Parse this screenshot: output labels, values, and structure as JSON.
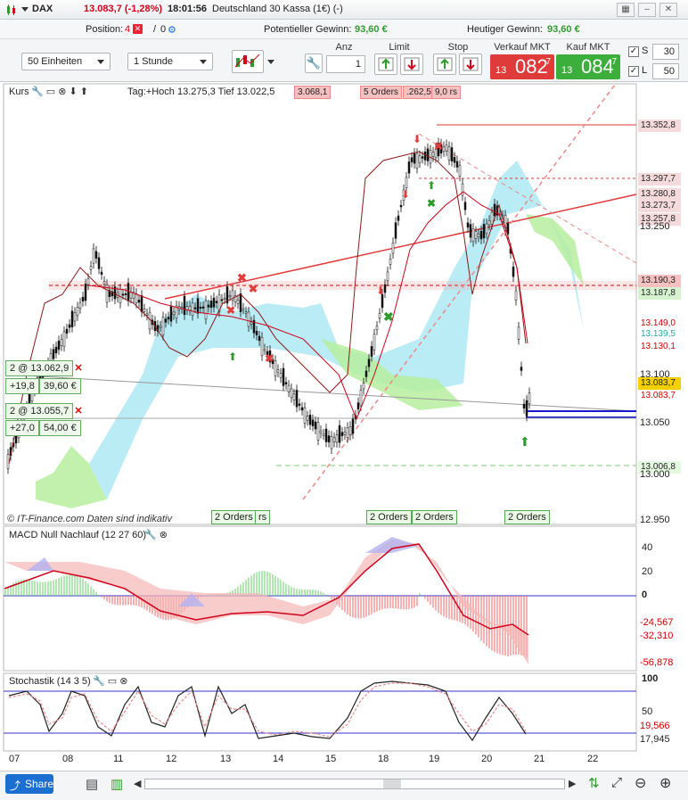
{
  "titlebar": {
    "instrument": "DAX",
    "price_change": "13.083,7 (-1,28%)",
    "time": "18:01:56",
    "instrument_full": "Deutschland 30 Kassa (1€) (-)"
  },
  "info_row": {
    "position_label": "Position:",
    "position_value": "4",
    "position_orders": "0",
    "potential_label": "Potentieller Gewinn:",
    "potential_value": "93,60 €",
    "today_label": "Heutiger Gewinn:",
    "today_value": "93,60 €"
  },
  "toolbar": {
    "units_select": "50 Einheiten",
    "timeframe_select": "1 Stunde",
    "qty_label": "Anz",
    "qty_value": "1",
    "limit_label": "Limit",
    "stop_label": "Stop",
    "sell_label": "Verkauf MKT",
    "buy_label": "Kauf MKT",
    "sell_small": "13",
    "sell_big": "082",
    "sell_sup": "7",
    "buy_small": "13",
    "buy_big": "084",
    "buy_sup": "7",
    "s_label": "S",
    "s_value": "30",
    "l_label": "L",
    "l_value": "50"
  },
  "price_panel": {
    "label": "Kurs",
    "header_info": "Tag:+Hoch 13.275,3 Tief 13.022,5",
    "header_orders_1": "3.068,1",
    "header_orders_2": "5 Orders",
    "header_orders_3": ".262,5",
    "header_orders_4": "9,0 rs",
    "watermark": "© IT-Finance.com  Daten sind indikativ",
    "y_ticks": [
      "13.250",
      "13.100",
      "13.050",
      "13.000",
      "12.950"
    ],
    "price_tags": [
      {
        "value": "13.352,8",
        "bg": "#f4dada",
        "fg": "#222"
      },
      {
        "value": "13.297,7",
        "bg": "#f4dada",
        "fg": "#222"
      },
      {
        "value": "13.280,8",
        "bg": "#f4dada",
        "fg": "#222"
      },
      {
        "value": "13.273,7",
        "bg": "#f4dada",
        "fg": "#222"
      },
      {
        "value": "13.257,8",
        "bg": "#f4dada",
        "fg": "#222"
      },
      {
        "value": "13.190,3",
        "bg": "#f4c0c0",
        "fg": "#222"
      },
      {
        "value": "13.187,8",
        "bg": "#d6f3d0",
        "fg": "#222"
      },
      {
        "value": "13.149,0",
        "bg": "#ffffff",
        "fg": "#c00"
      },
      {
        "value": "13.139,5",
        "bg": "#ffffff",
        "fg": "#2aa"
      },
      {
        "value": "13.130,1",
        "bg": "#ffffff",
        "fg": "#c00"
      },
      {
        "value": "13.083,7",
        "bg": "#f5d000",
        "fg": "#222"
      },
      {
        "value": "13.083,7",
        "bg": "#ffffff",
        "fg": "#c00"
      },
      {
        "value": "13.006,8",
        "bg": "#e4f7df",
        "fg": "#222"
      }
    ],
    "positions": [
      {
        "label": "2 @ 13.062,9",
        "pnl_points": "+19,8",
        "pnl_eur": "39,60 €"
      },
      {
        "label": "2 @ 13.055,7",
        "pnl_points": "+27,0",
        "pnl_eur": "54,00 €"
      }
    ],
    "order_pills": [
      "2 Orders",
      "rs",
      "2 Orders",
      "2 Orders",
      "2 Orders"
    ]
  },
  "macd_panel": {
    "label": "MACD Null Nachlauf (12 27 60)",
    "y_ticks": [
      "40",
      "20",
      "0"
    ],
    "values": [
      "-24,567",
      "-32,310",
      "-56,878"
    ]
  },
  "stoch_panel": {
    "label": "Stochastik (14 3 5)",
    "y_ticks": [
      "100",
      "50"
    ],
    "values": [
      "19,566",
      "17,945"
    ]
  },
  "date_axis": [
    "07",
    "08",
    "11",
    "12",
    "13",
    "14",
    "15",
    "18",
    "19",
    "20",
    "21",
    "22"
  ],
  "bottombar": {
    "share_label": "Share"
  },
  "colors": {
    "accent_red": "#d0021b",
    "accent_green": "#2e9b2e",
    "sell_box": "#e03b3b",
    "buy_box": "#3cae3c",
    "cloud_blue": "#9ee4f0",
    "cloud_green": "#b7ef9f"
  }
}
